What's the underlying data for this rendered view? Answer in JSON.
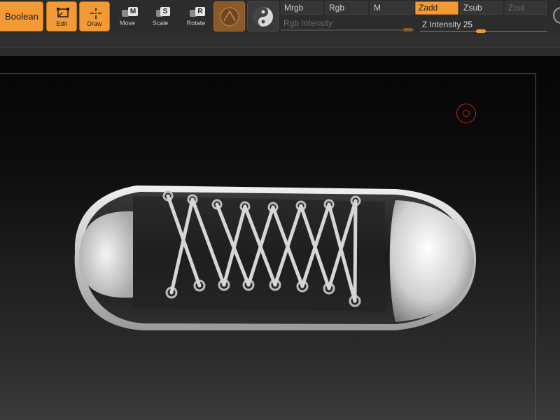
{
  "toolbar": {
    "boolean_label": "Boolean",
    "tools": [
      {
        "label": "Edit",
        "key": ""
      },
      {
        "label": "Draw",
        "key": ""
      },
      {
        "label": "Move",
        "key": "M"
      },
      {
        "label": "Scale",
        "key": "S"
      },
      {
        "label": "Rotate",
        "key": "R"
      }
    ],
    "modes": {
      "mrgb": "Mrgb",
      "rgb": "Rgb",
      "m": "M",
      "zadd": "Zadd",
      "zsub": "Zsub",
      "zcut": "Zcut"
    },
    "rgb_intensity_label": "Rgb Intensity",
    "z_intensity_label": "Z Intensity",
    "z_intensity_value": "25"
  },
  "colors": {
    "accent": "#f29a36",
    "cursor": "#c61e1e",
    "material_active": "#8a5a2a"
  },
  "icons": {
    "edit": "edit-box-icon",
    "draw": "draw-crosshair-icon",
    "material": "matcap-sphere-icon",
    "material_alt": "yin-yang-sphere-icon"
  }
}
